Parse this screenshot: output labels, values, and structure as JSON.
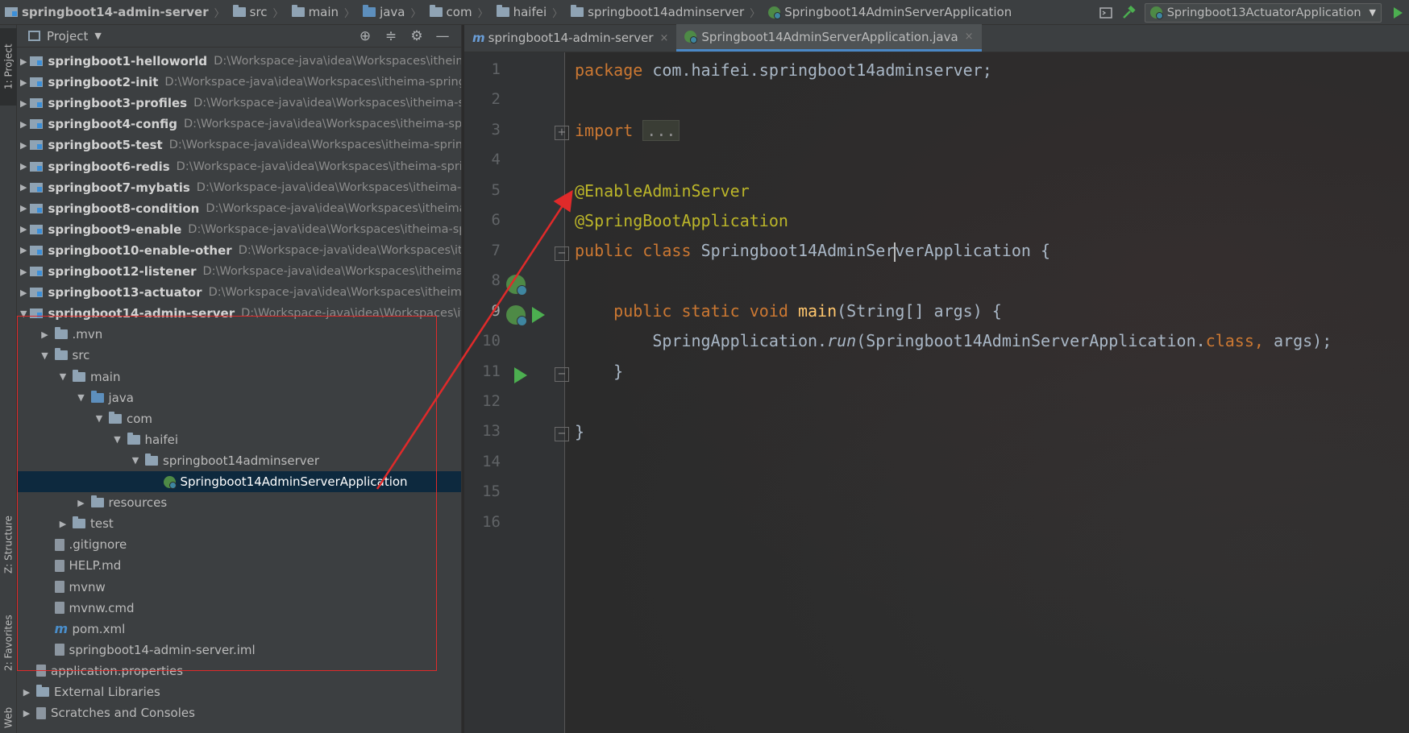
{
  "breadcrumb": [
    {
      "label": "springboot14-admin-server",
      "icon": "module-icon",
      "bold": true
    },
    {
      "label": "src",
      "icon": "folder-icon"
    },
    {
      "label": "main",
      "icon": "folder-icon"
    },
    {
      "label": "java",
      "icon": "source-folder-icon"
    },
    {
      "label": "com",
      "icon": "package-icon"
    },
    {
      "label": "haifei",
      "icon": "package-icon"
    },
    {
      "label": "springboot14adminserver",
      "icon": "package-icon"
    },
    {
      "label": "Springboot14AdminServerApplication",
      "icon": "spring-class-icon"
    }
  ],
  "toolbar": {
    "run_config": "Springboot13ActuatorApplication"
  },
  "stripe": {
    "project": "1: Project",
    "structure": "Z: Structure",
    "favorites": "2: Favorites",
    "web": "Web"
  },
  "project_panel": {
    "title": "Project",
    "rows": [
      {
        "name": "springboot1-helloworld",
        "path": "D:\\Workspace-java\\idea\\Workspaces\\itheima-springboot",
        "level": 0,
        "arrow": "right",
        "icon": "module",
        "bold": true
      },
      {
        "name": "springboot2-init",
        "path": "D:\\Workspace-java\\idea\\Workspaces\\itheima-springboot",
        "level": 0,
        "arrow": "right",
        "icon": "module",
        "bold": true
      },
      {
        "name": "springboot3-profiles",
        "path": "D:\\Workspace-java\\idea\\Workspaces\\itheima-springboot",
        "level": 0,
        "arrow": "right",
        "icon": "module",
        "bold": true
      },
      {
        "name": "springboot4-config",
        "path": "D:\\Workspace-java\\idea\\Workspaces\\itheima-springboot",
        "level": 0,
        "arrow": "right",
        "icon": "module",
        "bold": true
      },
      {
        "name": "springboot5-test",
        "path": "D:\\Workspace-java\\idea\\Workspaces\\itheima-springboot",
        "level": 0,
        "arrow": "right",
        "icon": "module",
        "bold": true
      },
      {
        "name": "springboot6-redis",
        "path": "D:\\Workspace-java\\idea\\Workspaces\\itheima-springboot",
        "level": 0,
        "arrow": "right",
        "icon": "module",
        "bold": true
      },
      {
        "name": "springboot7-mybatis",
        "path": "D:\\Workspace-java\\idea\\Workspaces\\itheima-springboot",
        "level": 0,
        "arrow": "right",
        "icon": "module",
        "bold": true
      },
      {
        "name": "springboot8-condition",
        "path": "D:\\Workspace-java\\idea\\Workspaces\\itheima-springboot",
        "level": 0,
        "arrow": "right",
        "icon": "module",
        "bold": true
      },
      {
        "name": "springboot9-enable",
        "path": "D:\\Workspace-java\\idea\\Workspaces\\itheima-springboot",
        "level": 0,
        "arrow": "right",
        "icon": "module",
        "bold": true
      },
      {
        "name": "springboot10-enable-other",
        "path": "D:\\Workspace-java\\idea\\Workspaces\\itheima-springboot",
        "level": 0,
        "arrow": "right",
        "icon": "module",
        "bold": true
      },
      {
        "name": "springboot12-listener",
        "path": "D:\\Workspace-java\\idea\\Workspaces\\itheima-springboot",
        "level": 0,
        "arrow": "right",
        "icon": "module",
        "bold": true
      },
      {
        "name": "springboot13-actuator",
        "path": "D:\\Workspace-java\\idea\\Workspaces\\itheima-springboot",
        "level": 0,
        "arrow": "right",
        "icon": "module",
        "bold": true
      },
      {
        "name": "springboot14-admin-server",
        "path": "D:\\Workspace-java\\idea\\Workspaces\\itheima-springboot",
        "level": 0,
        "arrow": "down",
        "icon": "module",
        "bold": true
      },
      {
        "name": ".mvn",
        "path": "",
        "level": 1,
        "arrow": "right",
        "icon": "folder"
      },
      {
        "name": "src",
        "path": "",
        "level": 1,
        "arrow": "down",
        "icon": "folder"
      },
      {
        "name": "main",
        "path": "",
        "level": 2,
        "arrow": "down",
        "icon": "folder"
      },
      {
        "name": "java",
        "path": "",
        "level": 3,
        "arrow": "down",
        "icon": "source-folder"
      },
      {
        "name": "com",
        "path": "",
        "level": 4,
        "arrow": "down",
        "icon": "package"
      },
      {
        "name": "haifei",
        "path": "",
        "level": 5,
        "arrow": "down",
        "icon": "package"
      },
      {
        "name": "springboot14adminserver",
        "path": "",
        "level": 6,
        "arrow": "down",
        "icon": "package"
      },
      {
        "name": "Springboot14AdminServerApplication",
        "path": "",
        "level": 7,
        "arrow": "none",
        "icon": "spring-class",
        "selected": true
      },
      {
        "name": "resources",
        "path": "",
        "level": 3,
        "arrow": "right",
        "icon": "resources-folder"
      },
      {
        "name": "test",
        "path": "",
        "level": 2,
        "arrow": "right",
        "icon": "folder"
      },
      {
        "name": ".gitignore",
        "path": "",
        "level": 1,
        "arrow": "none",
        "icon": "file"
      },
      {
        "name": "HELP.md",
        "path": "",
        "level": 1,
        "arrow": "none",
        "icon": "md-file"
      },
      {
        "name": "mvnw",
        "path": "",
        "level": 1,
        "arrow": "none",
        "icon": "file"
      },
      {
        "name": "mvnw.cmd",
        "path": "",
        "level": 1,
        "arrow": "none",
        "icon": "file"
      },
      {
        "name": "pom.xml",
        "path": "",
        "level": 1,
        "arrow": "none",
        "icon": "maven"
      },
      {
        "name": "springboot14-admin-server.iml",
        "path": "",
        "level": 1,
        "arrow": "none",
        "icon": "file"
      },
      {
        "name": "application.properties",
        "path": "",
        "level": 0,
        "arrow": "none",
        "icon": "properties-file"
      },
      {
        "name": "External Libraries",
        "path": "",
        "level": 0,
        "arrow": "right",
        "icon": "libraries"
      },
      {
        "name": "Scratches and Consoles",
        "path": "",
        "level": 0,
        "arrow": "right",
        "icon": "scratches"
      }
    ]
  },
  "editor_tabs": [
    {
      "label": "springboot14-admin-server",
      "icon": "maven",
      "active": false
    },
    {
      "label": "Springboot14AdminServerApplication.java",
      "icon": "spring-class",
      "active": true
    }
  ],
  "code": {
    "line_numbers": [
      "1",
      "2",
      "3",
      "4",
      "5",
      "6",
      "7",
      "8",
      "9",
      "10",
      "11",
      "12",
      "13",
      "14",
      "15",
      "16"
    ],
    "current_line": "9",
    "l1_kw": "package",
    "l1_rest": " com.haifei.springboot14adminserver;",
    "l3_kw": "import",
    "l3_folded": "...",
    "l7_ann": "@EnableAdminServer",
    "l8_ann": "@SpringBootApplication",
    "l9_kw1": "public",
    "l9_kw2": "class",
    "l9_name_a": "Springboot14AdminSer",
    "l9_name_b": "verApplication {",
    "l11_kw": "public static void",
    "l11_meth": "main",
    "l11_rest": "(String[] args) {",
    "l12_a": "SpringApplication.",
    "l12_run": "run",
    "l12_b": "(Springboot14AdminServerApplication.",
    "l12_kw": "class",
    "l12_c": ",",
    "l12_d": " args);",
    "l13": "}",
    "l15": "}"
  },
  "colors": {
    "keyword": "#cc7832",
    "annotation": "#bbb529",
    "method": "#ffc66d",
    "annotation_box": "#e02a2a"
  }
}
